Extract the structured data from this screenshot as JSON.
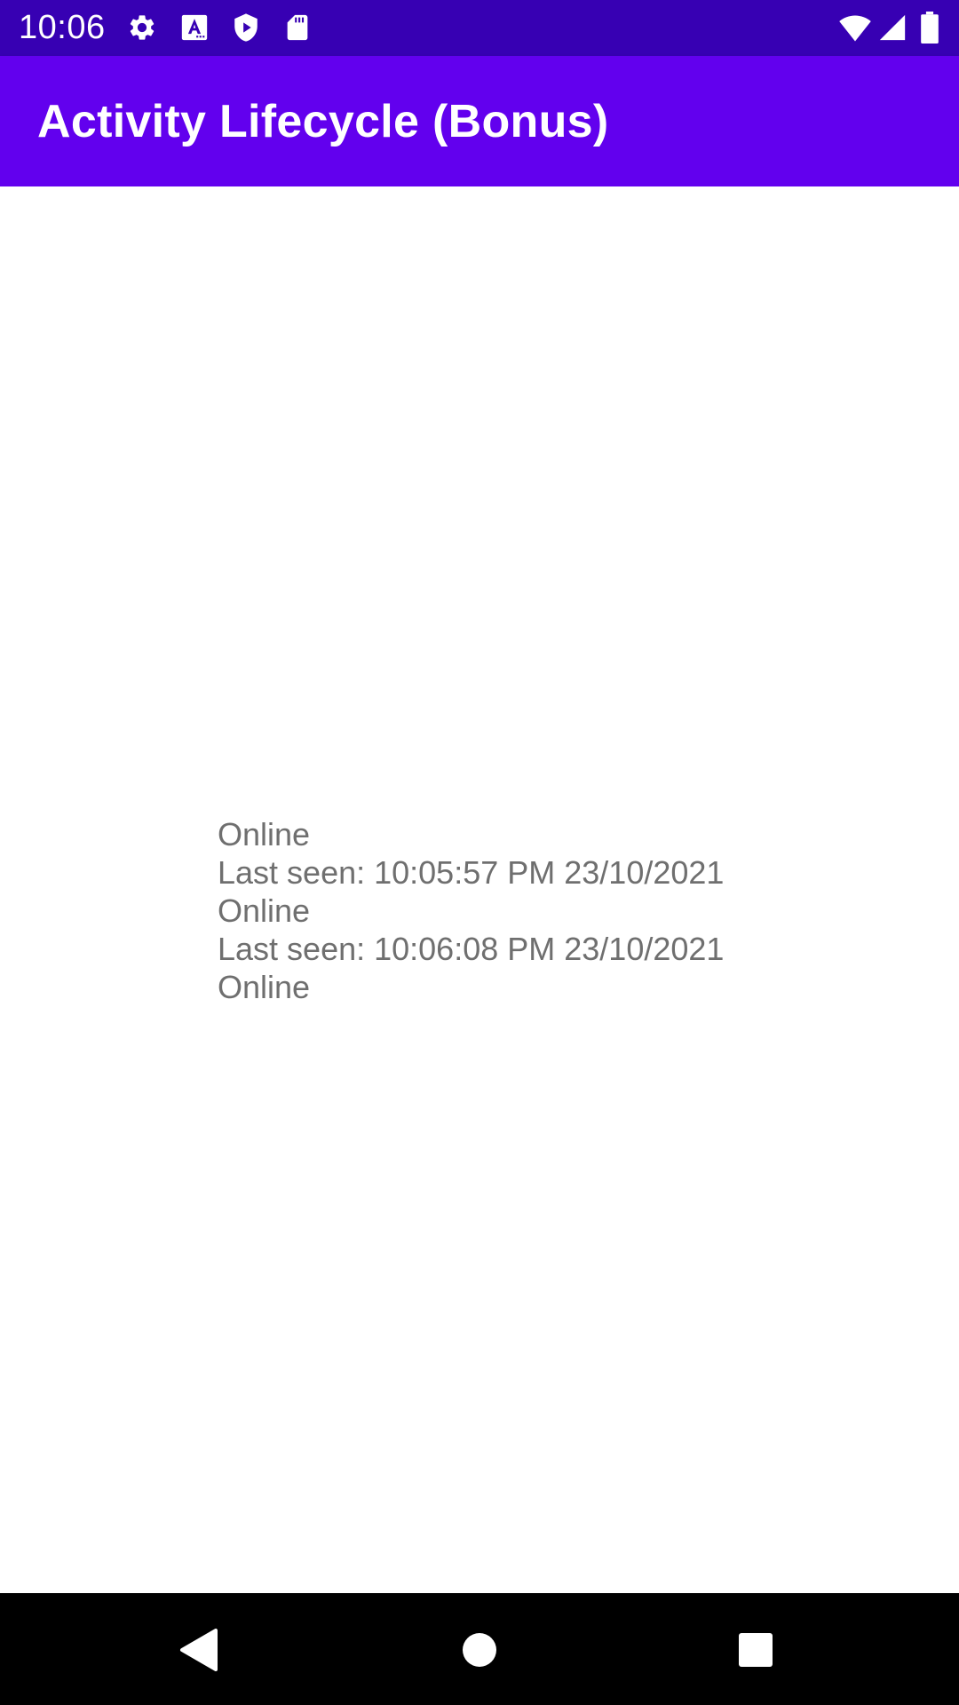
{
  "status_bar": {
    "time": "10:06",
    "background_color": "#3700b3",
    "left_icons": [
      "gear-icon",
      "font-a-icon",
      "play-protect-icon",
      "sd-card-icon"
    ],
    "right_icons": [
      "wifi-icon",
      "cellular-signal-icon",
      "battery-icon"
    ]
  },
  "app_bar": {
    "title": "Activity Lifecycle (Bonus)",
    "background_color": "#6200ee"
  },
  "main": {
    "log_lines": [
      "Online",
      "Last seen: 10:05:57 PM 23/10/2021",
      "Online",
      "Last seen: 10:06:08 PM 23/10/2021",
      "Online"
    ],
    "text_color": "#6f6f6f"
  },
  "nav_bar": {
    "buttons": [
      "back-icon",
      "home-icon",
      "recents-icon"
    ]
  }
}
